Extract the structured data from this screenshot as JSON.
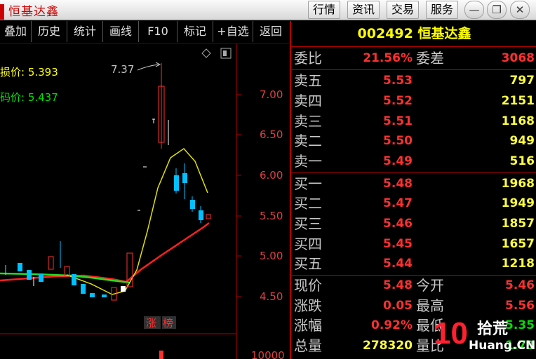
{
  "window": {
    "title": "恒基达鑫"
  },
  "titlebar_buttons": [
    "行情",
    "资讯",
    "交易",
    "服务"
  ],
  "window_controls": [
    "minimize-icon",
    "restore-icon",
    "close-icon"
  ],
  "toolbar": [
    "叠加",
    "历史",
    "统计",
    "画线",
    "F10",
    "标记",
    "+自选",
    "返回"
  ],
  "chart": {
    "stoploss_label": "损价: 5.393",
    "cost_label": "码价: 5.437",
    "peak_label": "7.37",
    "limit_badge_1": "涨",
    "limit_badge_2": "榜",
    "volume_tick": "10000"
  },
  "chart_data": {
    "type": "candlestick",
    "y_ticks": [
      "7.00",
      "6.50",
      "6.00",
      "5.50",
      "5.00",
      "4.50"
    ],
    "ylim": [
      4.35,
      7.45
    ],
    "annotations": [
      "7.37"
    ]
  },
  "quote": {
    "code_name": "002492 恒基达鑫",
    "weibi_label": "委比",
    "weibi_value": "21.56%",
    "weicha_label": "委差",
    "weicha_value": "3068",
    "asks": [
      {
        "label": "卖五",
        "price": "5.53",
        "vol": "797"
      },
      {
        "label": "卖四",
        "price": "5.52",
        "vol": "2151"
      },
      {
        "label": "卖三",
        "price": "5.51",
        "vol": "1168"
      },
      {
        "label": "卖二",
        "price": "5.50",
        "vol": "949"
      },
      {
        "label": "卖一",
        "price": "5.49",
        "vol": "516"
      }
    ],
    "bids": [
      {
        "label": "买一",
        "price": "5.48",
        "vol": "1968"
      },
      {
        "label": "买二",
        "price": "5.47",
        "vol": "1949"
      },
      {
        "label": "买三",
        "price": "5.46",
        "vol": "1857"
      },
      {
        "label": "买四",
        "price": "5.45",
        "vol": "1657"
      },
      {
        "label": "买五",
        "price": "5.44",
        "vol": "1218"
      }
    ],
    "stats": [
      {
        "l1": "现价",
        "v1": "5.48",
        "l2": "今开",
        "v2": "5.46"
      },
      {
        "l1": "涨跌",
        "v1": "0.05",
        "l2": "最高",
        "v2": "5.56"
      },
      {
        "l1": "涨幅",
        "v1": "0.92%",
        "l2": "最低",
        "v2": "5.35"
      },
      {
        "l1": "总量",
        "v1": "278320",
        "l2": "量比",
        "v2": "1.73"
      }
    ]
  },
  "watermark": {
    "text_big": "10",
    "text_cn": "拾荒",
    "text_site": "Huang.CN"
  }
}
